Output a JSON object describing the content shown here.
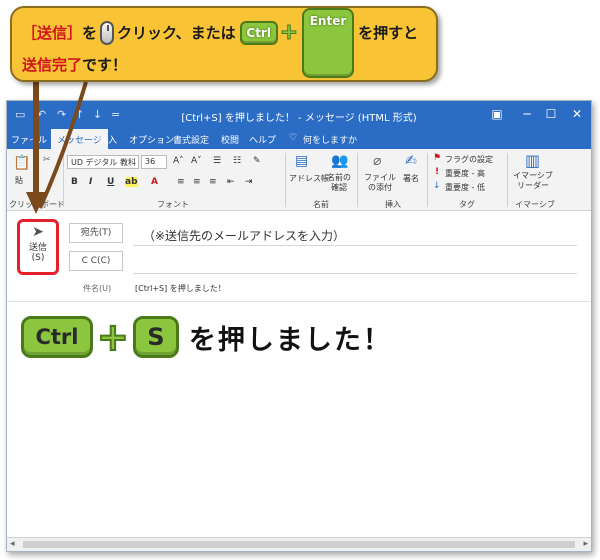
{
  "callout": {
    "send_bracket": "［送信］",
    "wo": "を",
    "click": "クリック、または",
    "ctrl": "Ctrl",
    "plus": "+",
    "enter": "Enter",
    "press": "を押すと",
    "send_done": "送信完了",
    "desu": "です！"
  },
  "window": {
    "title": "[Ctrl+S] を押しました！ - メッセージ (HTML 形式)",
    "quick_access": [
      "↶",
      "↷",
      "↑",
      "↓",
      "="
    ]
  },
  "tabs": [
    "ファイル",
    "メッセージ",
    "挿入",
    "オプション",
    "書式設定",
    "校閲",
    "ヘルプ",
    "何をしますか"
  ],
  "ribbon": {
    "paste": "貼",
    "font_name": "UD デジタル 教科",
    "font_size": "36",
    "address_book": "アドレス帳",
    "check_names": "名前の確認",
    "attach_file": "ファイルの添付",
    "signature": "署名",
    "flag": "フラグの設定",
    "high_importance": "重要度 - 高",
    "low_importance": "重要度 - 低",
    "immersive_reader": "イマーシブ リーダー",
    "groups": {
      "clipboard": "クリップボード",
      "font": "フォント",
      "names": "名前",
      "insert": "挿入",
      "tags": "タグ",
      "immersive": "イマーシブ"
    }
  },
  "compose": {
    "send_label": "送信",
    "send_key": "(S)",
    "to_button": "宛先(T)",
    "cc_button": "C C(C)",
    "to_placeholder": "（※送信先のメールアドレスを入力）",
    "subject_label": "件名(U)",
    "subject_value": "[Ctrl+S] を押しました！"
  },
  "body": {
    "ctrl": "Ctrl",
    "plus": "+",
    "s": "S",
    "text": "を押しました！"
  },
  "colors": {
    "accent": "#2b6cc4",
    "callout": "#f8c435",
    "key_green": "#8cc63f",
    "highlight_red": "#e5202a"
  }
}
